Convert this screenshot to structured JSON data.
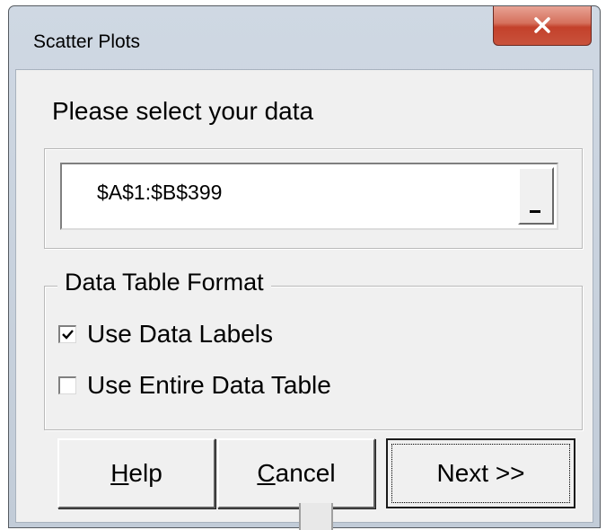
{
  "window": {
    "title": "Scatter Plots",
    "close_icon": "close-x-icon"
  },
  "prompt": "Please select your data",
  "range": {
    "value": "$A$1:$B$399",
    "ref_button_icon": "range-select-icon"
  },
  "format_group": {
    "legend": "Data Table Format",
    "options": [
      {
        "label": "Use Data Labels",
        "checked": true
      },
      {
        "label": "Use Entire Data Table",
        "checked": false
      }
    ]
  },
  "buttons": {
    "help": {
      "mnemonic": "H",
      "rest": "elp"
    },
    "cancel": {
      "mnemonic": "C",
      "rest": "ancel"
    },
    "next": "Next >>"
  },
  "colors": {
    "close_button": "#c3412b",
    "dialog_face": "#f0f0f0",
    "frame": "#c2ccd8"
  }
}
